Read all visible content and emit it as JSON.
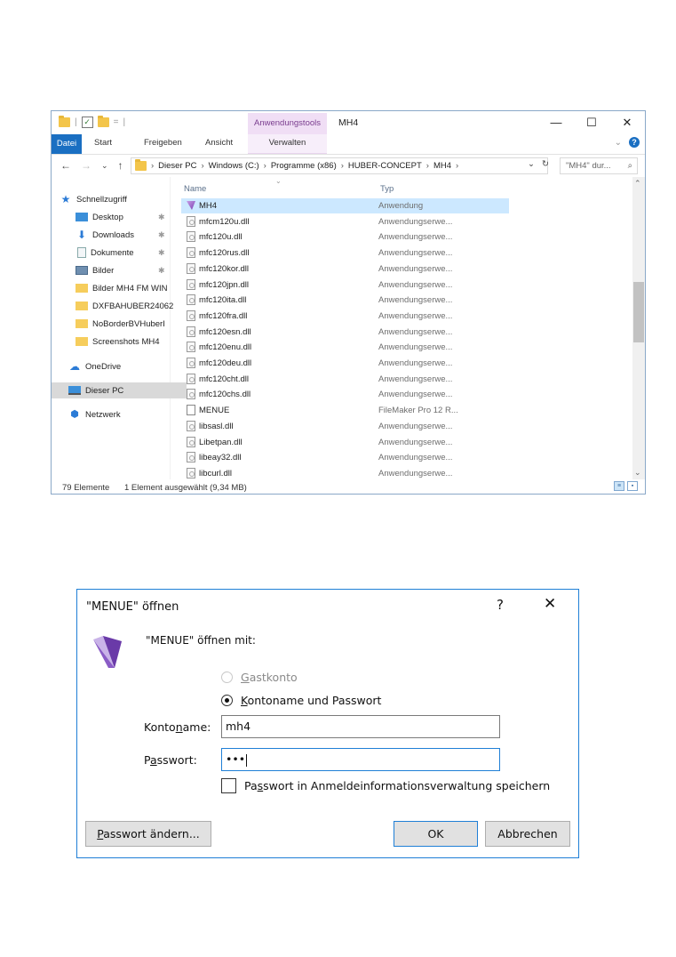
{
  "explorer": {
    "title": "MH4",
    "context_tab_group": "Anwendungstools",
    "qat_sep": "=",
    "window_controls": {
      "minimize": "—",
      "maximize": "☐",
      "close": "✕"
    },
    "ribbon_tabs": {
      "file": "Datei",
      "start": "Start",
      "share": "Freigeben",
      "view": "Ansicht",
      "manage": "Verwalten"
    },
    "ribbon_expand": "⌄",
    "help_glyph": "?",
    "nav_glyphs": {
      "back": "←",
      "forward": "→",
      "recent": "⌄",
      "up": "↑"
    },
    "breadcrumb": [
      "Dieser PC",
      "Windows (C:)",
      "Programme (x86)",
      "HUBER-CONCEPT",
      "MH4"
    ],
    "crumb_separator": "›",
    "address_dropdown": "⌄",
    "refresh_glyph": "↻",
    "search_placeholder": "\"MH4\" dur...",
    "search_glyph": "⌕",
    "nav_pane": [
      {
        "label": "Schnellzugriff",
        "icon": "star-icon"
      },
      {
        "label": "Desktop",
        "icon": "desktop-icon",
        "pinned": true
      },
      {
        "label": "Downloads",
        "icon": "download-arrow-icon",
        "pinned": true
      },
      {
        "label": "Dokumente",
        "icon": "document-icon",
        "pinned": true
      },
      {
        "label": "Bilder",
        "icon": "pictures-icon",
        "pinned": true
      },
      {
        "label": "Bilder MH4 FM WIN",
        "icon": "folder-icon"
      },
      {
        "label": "DXFBAHUBER24062",
        "icon": "folder-icon"
      },
      {
        "label": "NoBorderBVHuberI",
        "icon": "folder-icon"
      },
      {
        "label": "Screenshots MH4",
        "icon": "folder-icon"
      },
      {
        "label": "OneDrive",
        "icon": "cloud-icon"
      },
      {
        "label": "Dieser PC",
        "icon": "computer-icon",
        "selected": true
      },
      {
        "label": "Netzwerk",
        "icon": "network-icon"
      }
    ],
    "pin_glyph": "✱",
    "columns": {
      "name": "Name",
      "type": "Typ"
    },
    "sort_glyph": "⌄",
    "files": [
      {
        "name": "MH4",
        "type": "Anwendung",
        "icon": "app",
        "selected": true
      },
      {
        "name": "mfcm120u.dll",
        "type": "Anwendungserwe...",
        "icon": "dll"
      },
      {
        "name": "mfc120u.dll",
        "type": "Anwendungserwe...",
        "icon": "dll"
      },
      {
        "name": "mfc120rus.dll",
        "type": "Anwendungserwe...",
        "icon": "dll"
      },
      {
        "name": "mfc120kor.dll",
        "type": "Anwendungserwe...",
        "icon": "dll"
      },
      {
        "name": "mfc120jpn.dll",
        "type": "Anwendungserwe...",
        "icon": "dll"
      },
      {
        "name": "mfc120ita.dll",
        "type": "Anwendungserwe...",
        "icon": "dll"
      },
      {
        "name": "mfc120fra.dll",
        "type": "Anwendungserwe...",
        "icon": "dll"
      },
      {
        "name": "mfc120esn.dll",
        "type": "Anwendungserwe...",
        "icon": "dll"
      },
      {
        "name": "mfc120enu.dll",
        "type": "Anwendungserwe...",
        "icon": "dll"
      },
      {
        "name": "mfc120deu.dll",
        "type": "Anwendungserwe...",
        "icon": "dll"
      },
      {
        "name": "mfc120cht.dll",
        "type": "Anwendungserwe...",
        "icon": "dll"
      },
      {
        "name": "mfc120chs.dll",
        "type": "Anwendungserwe...",
        "icon": "dll"
      },
      {
        "name": "MENUE",
        "type": "FileMaker Pro 12 R...",
        "icon": "fm"
      },
      {
        "name": "libsasl.dll",
        "type": "Anwendungserwe...",
        "icon": "dll"
      },
      {
        "name": "Libetpan.dll",
        "type": "Anwendungserwe...",
        "icon": "dll"
      },
      {
        "name": "libeay32.dll",
        "type": "Anwendungserwe...",
        "icon": "dll"
      },
      {
        "name": "libcurl.dll",
        "type": "Anwendungserwe...",
        "icon": "dll"
      }
    ],
    "scroll_glyphs": {
      "up": "⌃",
      "down": "⌄"
    },
    "status": {
      "count": "79 Elemente",
      "selection": "1 Element ausgewählt (9,34 MB)"
    }
  },
  "dialog": {
    "title": "\"MENUE\" öffnen",
    "help_glyph": "?",
    "close_glyph": "✕",
    "prompt": "\"MENUE\" öffnen mit:",
    "radio_guest": {
      "pre": "",
      "accel": "G",
      "post": "astkonto"
    },
    "radio_account": {
      "pre": "",
      "accel": "K",
      "post": "ontoname und Passwort"
    },
    "account_label": {
      "pre": "Konto",
      "accel": "n",
      "post": "ame:"
    },
    "account_value": "mh4",
    "password_label": {
      "pre": "P",
      "accel": "a",
      "post": "sswort:"
    },
    "password_value": "•••",
    "save_checkbox": {
      "pre": "Pa",
      "accel": "s",
      "post": "swort in Anmeldeinformationsverwaltung speichern"
    },
    "change_password_button": {
      "pre": "",
      "accel": "P",
      "post": "asswort ändern..."
    },
    "ok_button": "OK",
    "cancel_button": "Abbrechen"
  }
}
